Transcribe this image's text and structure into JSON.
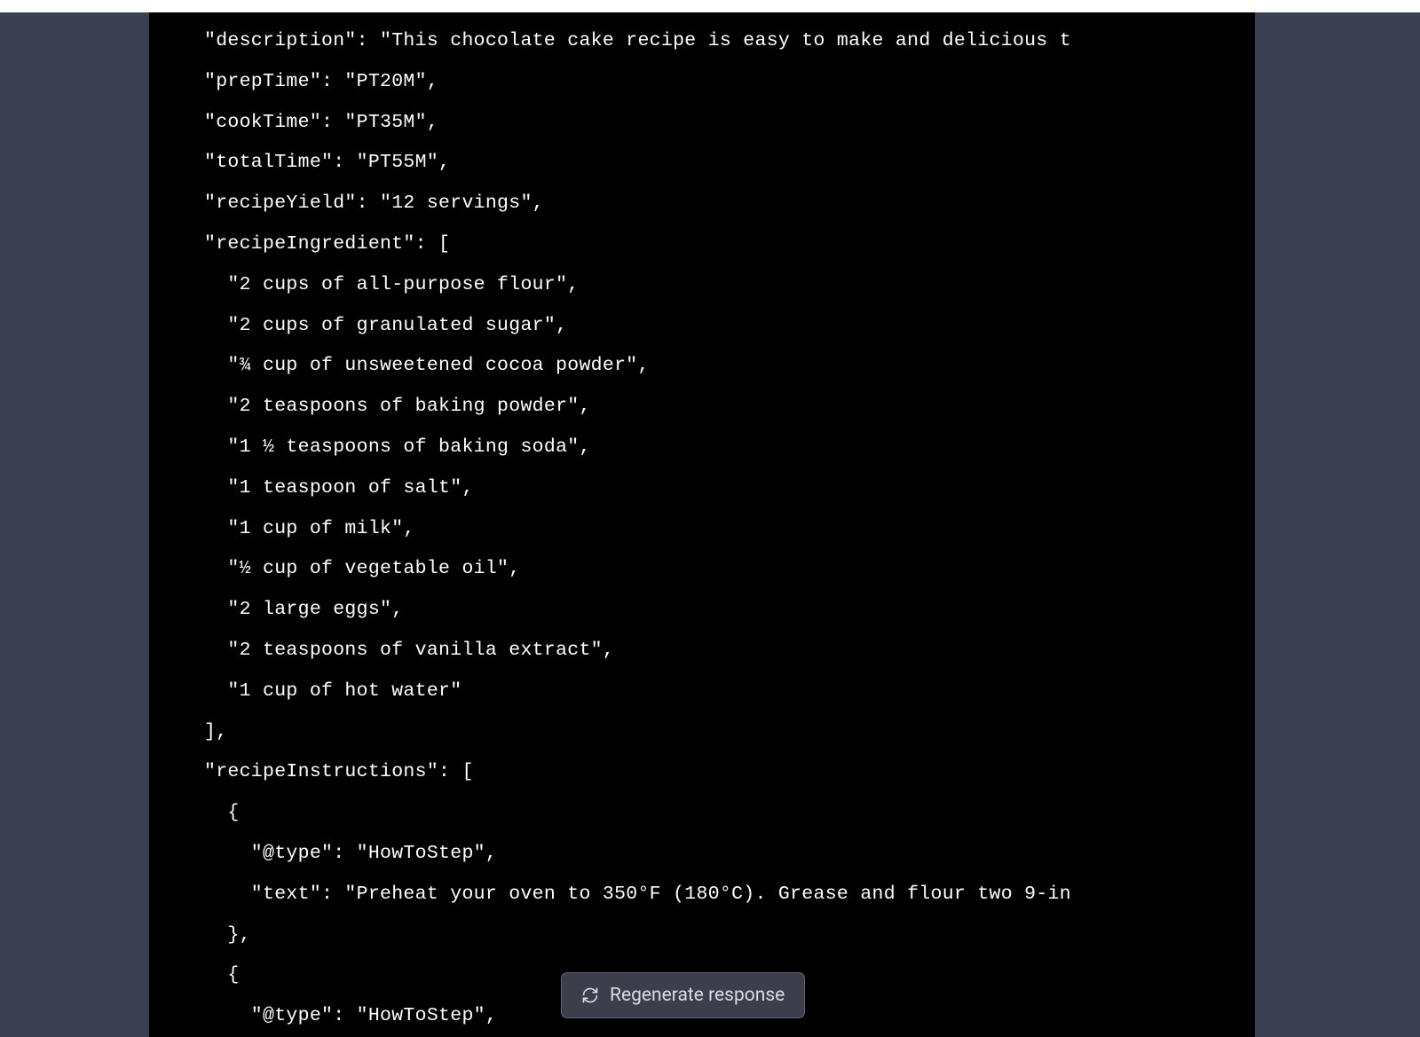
{
  "code": {
    "lines": [
      "\"description\": \"This chocolate cake recipe is easy to make and delicious t",
      "\"prepTime\": \"PT20M\",",
      "\"cookTime\": \"PT35M\",",
      "\"totalTime\": \"PT55M\",",
      "\"recipeYield\": \"12 servings\",",
      "\"recipeIngredient\": [",
      "  \"2 cups of all-purpose flour\",",
      "  \"2 cups of granulated sugar\",",
      "  \"¾ cup of unsweetened cocoa powder\",",
      "  \"2 teaspoons of baking powder\",",
      "  \"1 ½ teaspoons of baking soda\",",
      "  \"1 teaspoon of salt\",",
      "  \"1 cup of milk\",",
      "  \"½ cup of vegetable oil\",",
      "  \"2 large eggs\",",
      "  \"2 teaspoons of vanilla extract\",",
      "  \"1 cup of hot water\"",
      "],",
      "\"recipeInstructions\": [",
      "  {",
      "    \"@type\": \"HowToStep\",",
      "    \"text\": \"Preheat your oven to 350°F (180°C). Grease and flour two 9-in",
      "  },",
      "  {",
      "    \"@type\": \"HowToStep\","
    ]
  },
  "button": {
    "regenerate_label": "Regenerate response"
  }
}
